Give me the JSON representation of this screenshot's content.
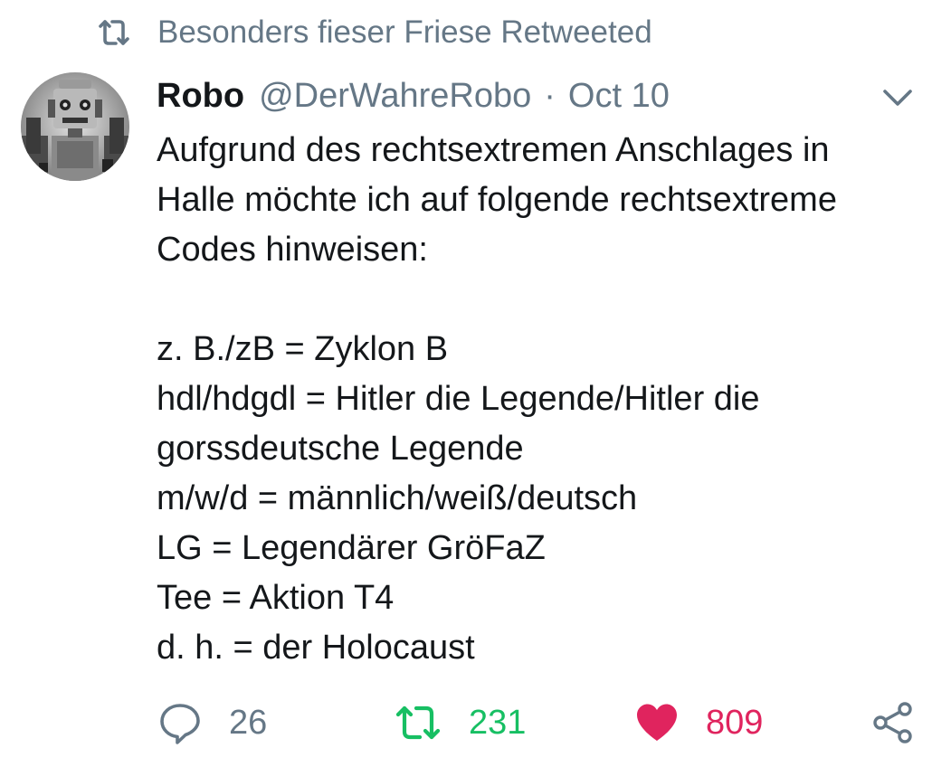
{
  "retweet_context": {
    "icon": "retweet-icon",
    "text": "Besonders fieser Friese Retweeted"
  },
  "author": {
    "name": "Robo",
    "handle": "@DerWahreRobo",
    "separator": "·",
    "date": "Oct 10"
  },
  "tweet_lines": [
    "Aufgrund des rechtsextremen Anschlages in",
    "Halle möchte ich auf folgende rechtsextreme",
    "Codes hinweisen:",
    "",
    "z. B./zB = Zyklon B",
    "hdl/hdgdl = Hitler die Legende/Hitler die",
    "gorssdeutsche Legende",
    "m/w/d = männlich/weiß/deutsch",
    "LG = Legendärer GröFaZ",
    "Tee = Aktion T4",
    "d. h. = der Holocaust"
  ],
  "actions": {
    "reply": {
      "icon": "reply-icon",
      "count": "26"
    },
    "retweet": {
      "icon": "retweet-icon",
      "count": "231"
    },
    "like": {
      "icon": "heart-icon",
      "count": "809"
    },
    "share": {
      "icon": "share-icon"
    }
  },
  "colors": {
    "muted": "#657786",
    "text": "#14171a",
    "retweet_green": "#17bf63",
    "like_red": "#e0245e"
  }
}
